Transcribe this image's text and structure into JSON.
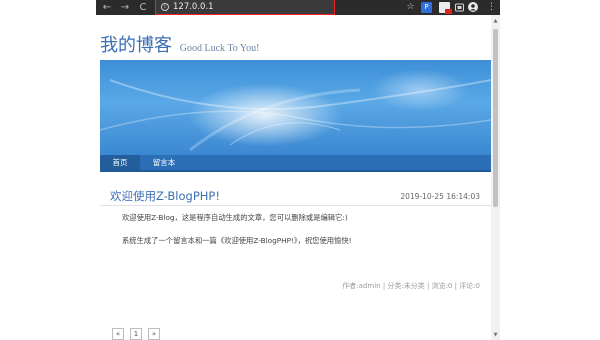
{
  "browser": {
    "url": "127.0.0.1",
    "back_glyph": "←",
    "forward_glyph": "→",
    "reload_glyph": "C",
    "star_glyph": "☆",
    "p_icon_label": "P",
    "menu_glyph": "⋮",
    "url_border_color": "#ee2222"
  },
  "site": {
    "title": "我的博客",
    "subtitle": "Good Luck To You!",
    "accent_color": "#3d6fb4"
  },
  "nav": {
    "items": [
      {
        "label": "首页"
      },
      {
        "label": "留言本"
      }
    ]
  },
  "post": {
    "title": "欢迎使用Z-BlogPHP!",
    "date": "2019-10-25 16:14:03",
    "paragraph1": "欢迎使用Z-Blog，这是程序自动生成的文章，您可以删除或是编辑它:)",
    "paragraph2": "系统生成了一个留言本和一篇《欢迎使用Z-BlogPHP!》，祝您使用愉快!",
    "meta": "作者:admin | 分类:未分类 | 浏览:0 | 评论:0"
  },
  "pagination": {
    "first": "«",
    "current": "1",
    "last": "»"
  }
}
